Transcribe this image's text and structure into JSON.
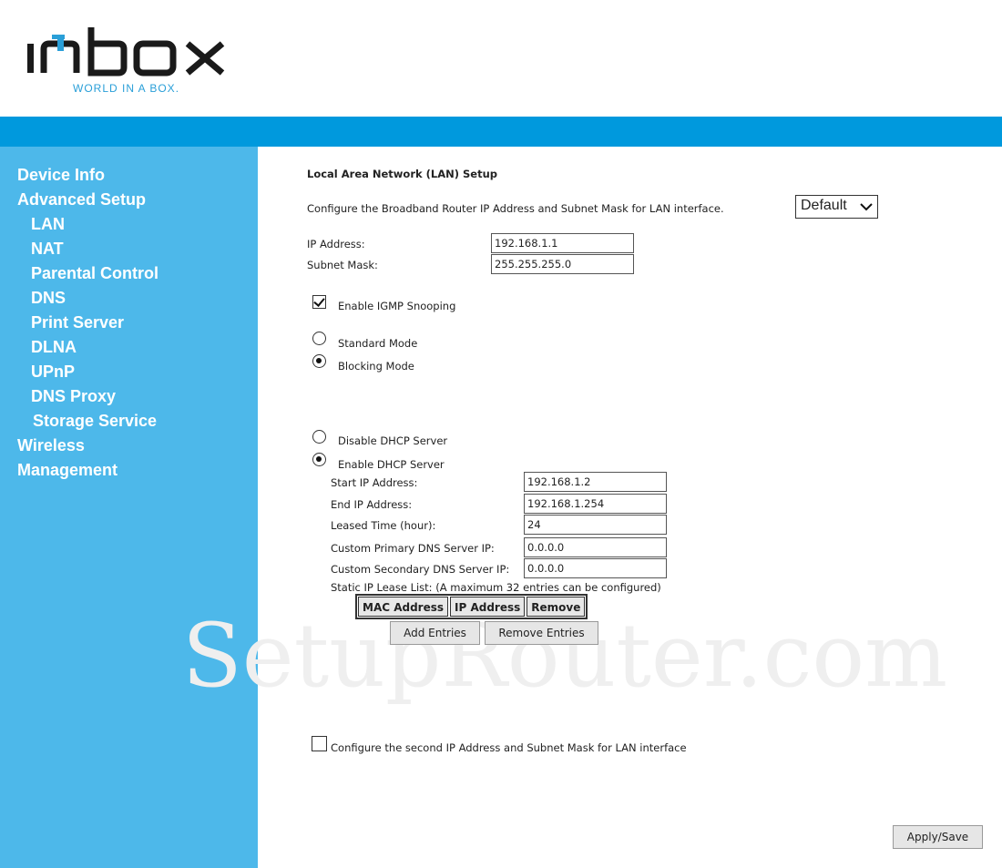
{
  "brand": {
    "logo_text": "imbox",
    "tagline": "WORLD IN A BOX.",
    "color": "#2a9fd8"
  },
  "colors": {
    "topbar": "#0099dd",
    "sidebar": "#4db8ea"
  },
  "sidebar": {
    "items": [
      {
        "label": "Device Info"
      },
      {
        "label": "Advanced Setup"
      },
      {
        "label": "LAN"
      },
      {
        "label": "NAT"
      },
      {
        "label": "Parental Control"
      },
      {
        "label": "DNS"
      },
      {
        "label": "Print Server"
      },
      {
        "label": "DLNA"
      },
      {
        "label": "UPnP"
      },
      {
        "label": "DNS Proxy"
      },
      {
        "label": "Storage Service"
      },
      {
        "label": "Wireless"
      },
      {
        "label": "Management"
      }
    ]
  },
  "main": {
    "title": "Local Area Network (LAN) Setup",
    "description": "Configure the Broadband Router IP Address and Subnet Mask for LAN interface.",
    "group_select": {
      "value": "Default",
      "icon": "chevron-down-icon"
    },
    "ip_address": {
      "label": "IP Address:",
      "value": "192.168.1.1"
    },
    "subnet_mask": {
      "label": "Subnet Mask:",
      "value": "255.255.255.0"
    },
    "igmp_snooping": {
      "label": "Enable IGMP Snooping",
      "checked": true
    },
    "standard_mode": {
      "label": "Standard Mode",
      "selected": false
    },
    "blocking_mode": {
      "label": "Blocking Mode",
      "selected": true
    },
    "disable_dhcp": {
      "label": "Disable DHCP Server",
      "selected": false
    },
    "enable_dhcp": {
      "label": "Enable DHCP Server",
      "selected": true
    },
    "dhcp": {
      "start_ip": {
        "label": "Start IP Address:",
        "value": "192.168.1.2"
      },
      "end_ip": {
        "label": "End IP Address:",
        "value": "192.168.1.254"
      },
      "leased_time": {
        "label": "Leased Time (hour):",
        "value": "24"
      },
      "primary_dns": {
        "label": "Custom Primary DNS Server IP:",
        "value": "0.0.0.0"
      },
      "secondary_dns": {
        "label": "Custom Secondary DNS Server IP:",
        "value": "0.0.0.0"
      }
    },
    "static_lease": {
      "label": "Static IP Lease List: (A maximum 32 entries can be configured)",
      "columns": [
        "MAC Address",
        "IP Address",
        "Remove"
      ]
    },
    "add_entries": "Add Entries",
    "remove_entries": "Remove Entries",
    "second_ip": {
      "label": "Configure the second IP Address and Subnet Mask for LAN interface",
      "checked": false
    },
    "apply_save": "Apply/Save"
  },
  "watermark": "SetupRouter.com"
}
